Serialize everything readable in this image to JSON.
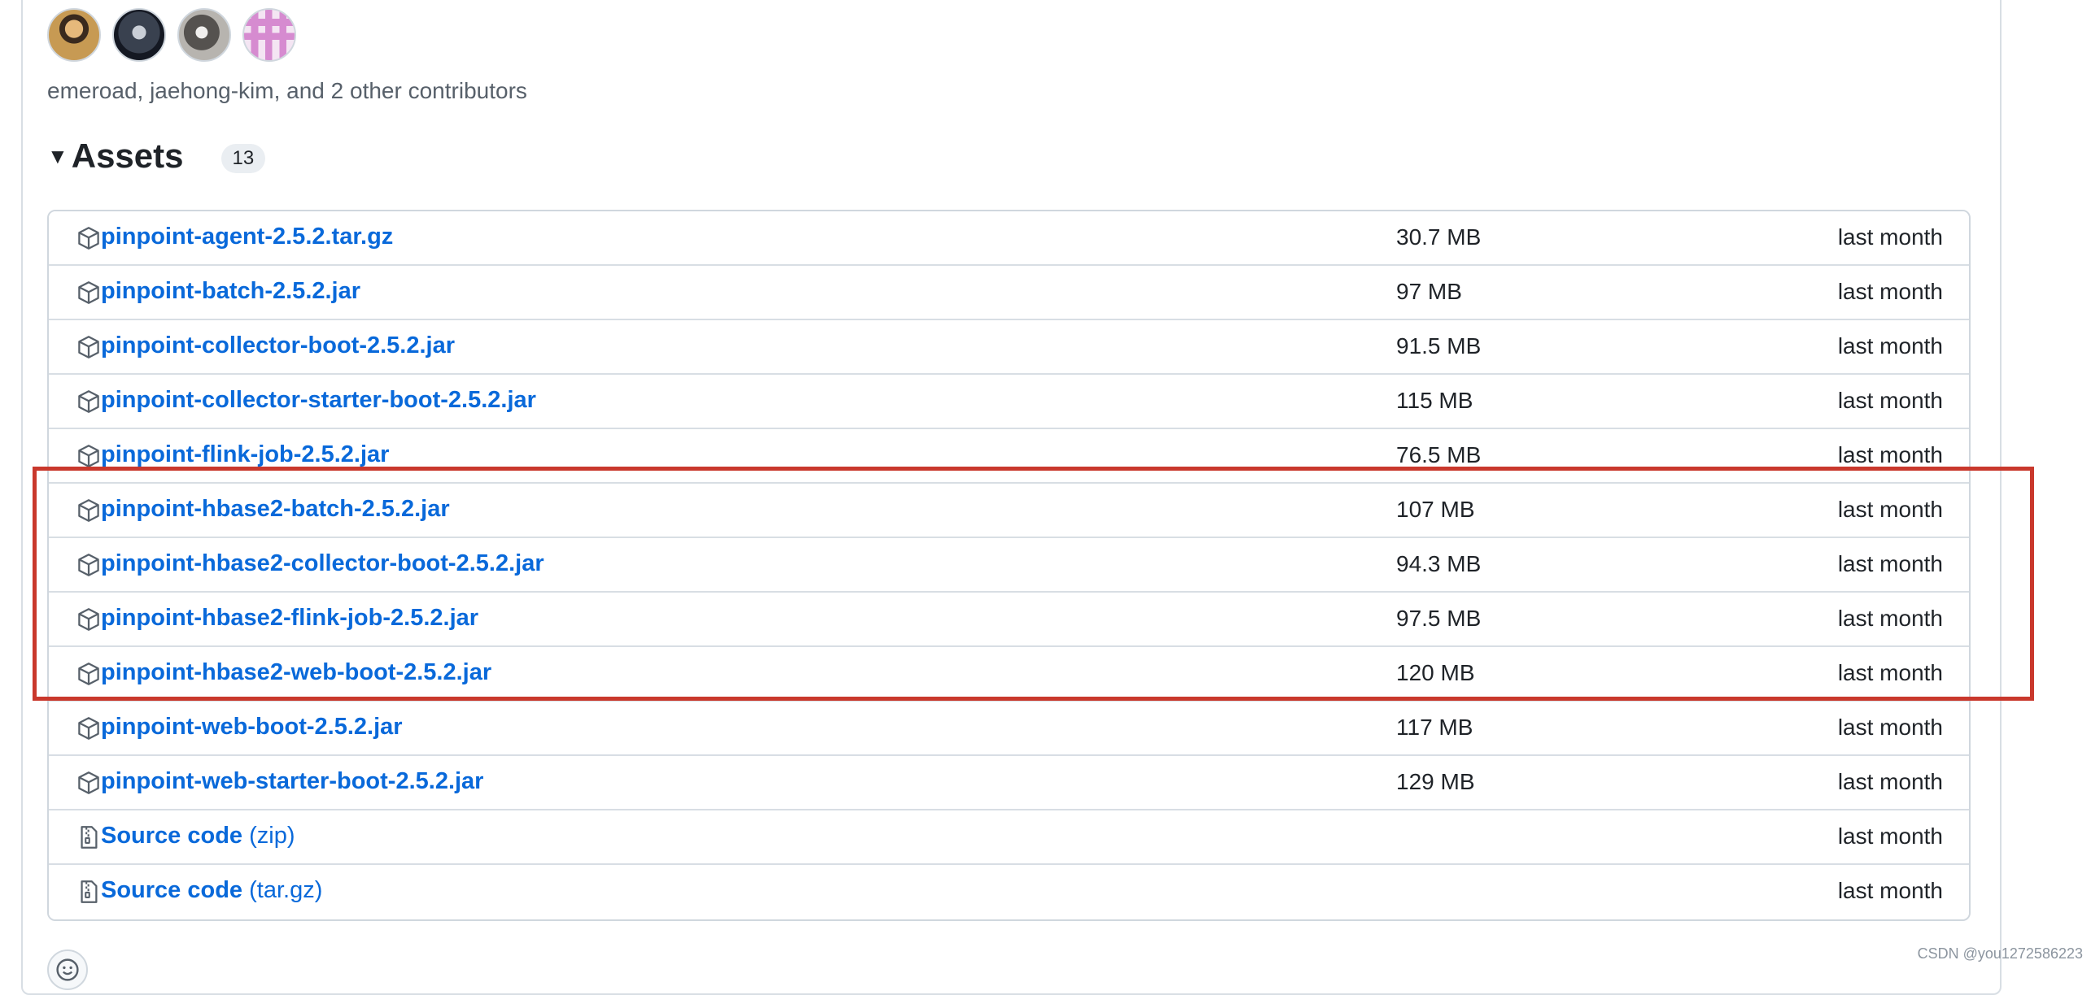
{
  "release": {
    "contributors_text": "emeroad, jaehong-kim, and 2 other contributors",
    "avatars": [
      "emeroad",
      "jaehong-kim",
      "contributor-3",
      "contributor-4"
    ]
  },
  "assets": {
    "title": "Assets",
    "count": "13",
    "items": [
      {
        "name": "pinpoint-agent-2.5.2.tar.gz",
        "suffix": "",
        "size": "30.7 MB",
        "date": "last month",
        "icon": "package-icon"
      },
      {
        "name": "pinpoint-batch-2.5.2.jar",
        "suffix": "",
        "size": "97 MB",
        "date": "last month",
        "icon": "package-icon"
      },
      {
        "name": "pinpoint-collector-boot-2.5.2.jar",
        "suffix": "",
        "size": "91.5 MB",
        "date": "last month",
        "icon": "package-icon"
      },
      {
        "name": "pinpoint-collector-starter-boot-2.5.2.jar",
        "suffix": "",
        "size": "115 MB",
        "date": "last month",
        "icon": "package-icon"
      },
      {
        "name": "pinpoint-flink-job-2.5.2.jar",
        "suffix": "",
        "size": "76.5 MB",
        "date": "last month",
        "icon": "package-icon"
      },
      {
        "name": "pinpoint-hbase2-batch-2.5.2.jar",
        "suffix": "",
        "size": "107 MB",
        "date": "last month",
        "icon": "package-icon"
      },
      {
        "name": "pinpoint-hbase2-collector-boot-2.5.2.jar",
        "suffix": "",
        "size": "94.3 MB",
        "date": "last month",
        "icon": "package-icon"
      },
      {
        "name": "pinpoint-hbase2-flink-job-2.5.2.jar",
        "suffix": "",
        "size": "97.5 MB",
        "date": "last month",
        "icon": "package-icon"
      },
      {
        "name": "pinpoint-hbase2-web-boot-2.5.2.jar",
        "suffix": "",
        "size": "120 MB",
        "date": "last month",
        "icon": "package-icon"
      },
      {
        "name": "pinpoint-web-boot-2.5.2.jar",
        "suffix": "",
        "size": "117 MB",
        "date": "last month",
        "icon": "package-icon"
      },
      {
        "name": "pinpoint-web-starter-boot-2.5.2.jar",
        "suffix": "",
        "size": "129 MB",
        "date": "last month",
        "icon": "package-icon"
      },
      {
        "name": "Source code",
        "suffix": " (zip)",
        "size": "",
        "date": "last month",
        "icon": "file-zip-icon"
      },
      {
        "name": "Source code",
        "suffix": " (tar.gz)",
        "size": "",
        "date": "last month",
        "icon": "file-zip-icon"
      }
    ]
  },
  "colors": {
    "link": "#0969da",
    "highlight_border": "#c9382c"
  },
  "watermark": "CSDN @you1272586223"
}
